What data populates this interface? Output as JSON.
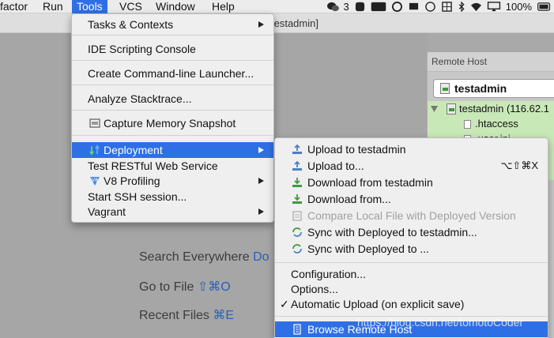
{
  "menubar": {
    "items": [
      "factor",
      "Run",
      "Tools",
      "VCS",
      "Window",
      "Help"
    ],
    "wechat_count": "3",
    "battery": "100%"
  },
  "window": {
    "title_fragment": "testadmin]"
  },
  "welcome": {
    "search": {
      "label": "Search Everywhere",
      "shortcut": "Do"
    },
    "goto": {
      "label": "Go to File",
      "shortcut": "⇧⌘O"
    },
    "recent": {
      "label": "Recent Files",
      "shortcut": "⌘E"
    }
  },
  "remote": {
    "panel_title": "Remote Host",
    "selected_host": "testadmin",
    "tree_root": "testadmin (116.62.1",
    "files": [
      ".htaccess",
      ".user.ini"
    ]
  },
  "tools_menu": {
    "items": [
      "Tasks & Contexts",
      "IDE Scripting Console",
      "Create Command-line Launcher...",
      "Analyze Stacktrace...",
      "Capture Memory Snapshot",
      "Deployment",
      "Test RESTful Web Service",
      "V8 Profiling",
      "Start SSH session...",
      "Vagrant"
    ]
  },
  "deploy_menu": {
    "items": [
      "Upload to testadmin",
      "Upload to...",
      "Download from testadmin",
      "Download from...",
      "Compare Local File with Deployed Version",
      "Sync with Deployed to testadmin...",
      "Sync with Deployed to ...",
      "Configuration...",
      "Options...",
      "Automatic Upload (on explicit save)",
      "Browse Remote Host"
    ],
    "upload_to_shortcut": "⌥⇧⌘X",
    "check_mark": "✓"
  },
  "watermark": "https://blog.csdn.net/tomotoCoder",
  "colors": {
    "accent": "#2f6fe5",
    "tree_bg": "#c9e8b8"
  }
}
